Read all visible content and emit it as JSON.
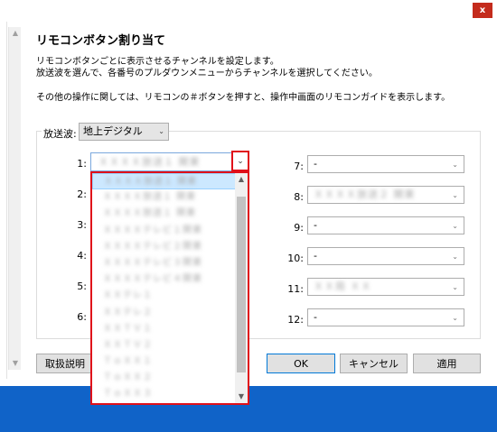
{
  "window": {
    "close_glyph": "x"
  },
  "dialog": {
    "title": "リモコンボタン割り当て",
    "desc_line1": "リモコンボタンごとに表示させるチャンネルを設定します。",
    "desc_line2": "放送波を選んで、各番号のプルダウンメニューからチャンネルを選択してください。",
    "desc_line3": "その他の操作に関しては、リモコンの＃ボタンを押すと、操作中画面のリモコンガイドを表示します。"
  },
  "broadcast": {
    "label": "放送波:",
    "value": "地上デジタル"
  },
  "channels": {
    "1": {
      "label": "1:",
      "value": "ＸＸＸＸ放送１ 関東"
    },
    "2": {
      "label": "2:"
    },
    "3": {
      "label": "3:"
    },
    "4": {
      "label": "4:"
    },
    "5": {
      "label": "5:"
    },
    "6": {
      "label": "6:"
    },
    "7": {
      "label": "7:",
      "value": "-"
    },
    "8": {
      "label": "8:",
      "value": "ＸＸＸＸ放送２ 関東"
    },
    "9": {
      "label": "9:",
      "value": "-"
    },
    "10": {
      "label": "10:",
      "value": "-"
    },
    "11": {
      "label": "11:",
      "value": "ＸＸ局 ＸＸ"
    },
    "12": {
      "label": "12:",
      "value": "-"
    }
  },
  "dropdown_options": [
    "ＸＸＸＸ放送１ 関東",
    "ＸＸＸＸ放送１ 関東",
    "ＸＸＸＸ放送１ 関東",
    "ＸＸＸＸテレビ１関東",
    "ＸＸＸＸテレビ２関東",
    "ＸＸＸＸテレビ３関東",
    "ＸＸＸＸテレビ４関東",
    "ＸＸテレ１",
    "ＸＸテレ２",
    "ＸＸＴＶ１",
    "ＸＸＴＶ２",
    "ＴｏＸＸ１",
    "ＴｏＸＸ２",
    "ＴｏＸＸ３",
    "ＸＸＸＰＬＣＴ１_１",
    "ＸＸ"
  ],
  "buttons": {
    "manual": "取扱説明",
    "ok": "OK",
    "cancel": "キャンセル",
    "apply": "適用"
  },
  "icons": {
    "chevron_down": "⌄",
    "scroll_up": "▲",
    "scroll_down": "▼"
  }
}
